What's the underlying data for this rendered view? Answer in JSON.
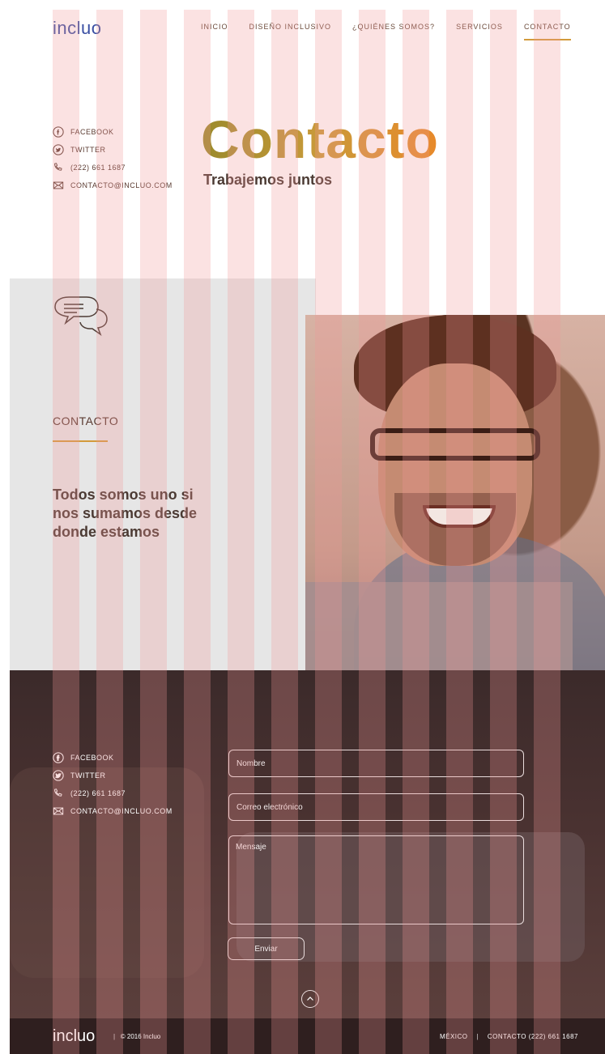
{
  "header": {
    "logo": "incluo",
    "nav": [
      {
        "label": "INICIO"
      },
      {
        "label": "DISEÑO INCLUSIVO"
      },
      {
        "label": "¿QUIÉNES SOMOS?"
      },
      {
        "label": "SERVICIOS"
      },
      {
        "label": "CONTACTO",
        "active": true
      }
    ]
  },
  "hero": {
    "title": "Contacto",
    "subtitle": "Trabajemos juntos",
    "social": {
      "facebook": "FACEBOOK",
      "twitter": "TWITTER",
      "phone": "(222) 661 1687",
      "email": "CONTACTO@INCLUO.COM"
    }
  },
  "contact_block": {
    "label": "CONTACTO",
    "quote": "Todos somos uno si nos sumamos desde donde estamos",
    "icon": "chat-bubbles-icon"
  },
  "form": {
    "name_placeholder": "Nombre",
    "email_placeholder": "Correo electrónico",
    "message_placeholder": "Mensaje",
    "send_label": "Enviar",
    "social": {
      "facebook": "FACEBOOK",
      "twitter": "TWITTER",
      "phone": "(222) 661 1687",
      "email": "CONTACTO@INCLUO.COM"
    }
  },
  "footer": {
    "logo": "incluo",
    "separator": "|",
    "copyright": "© 2016 Incluo",
    "country": "MÉXICO",
    "contact": "CONTACTO (222) 661 1687"
  },
  "colors": {
    "accent": "#d39a3b",
    "text_dark": "#4b3a33",
    "logo_blue": "#3a4fa3"
  }
}
